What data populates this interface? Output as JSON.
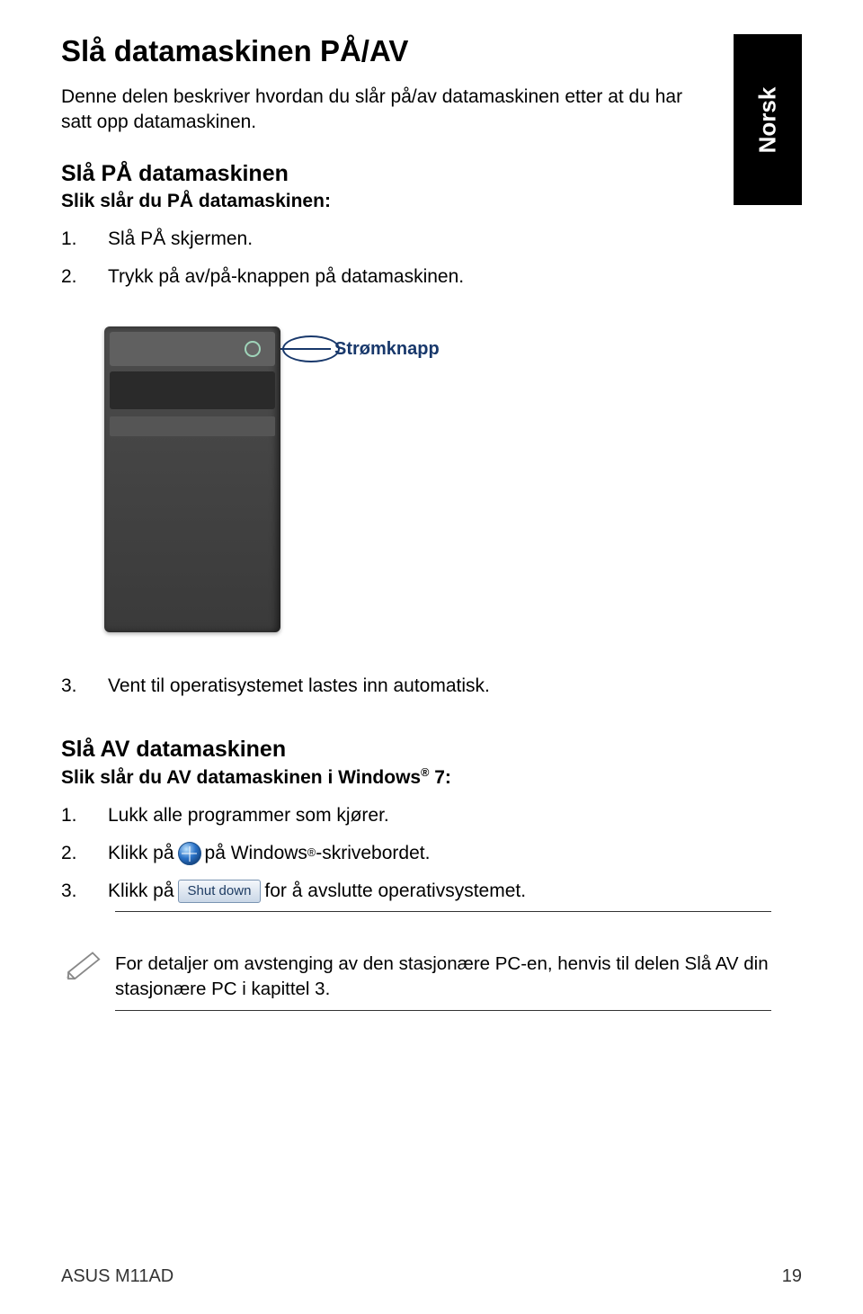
{
  "sideTab": "Norsk",
  "title": "Slå datamaskinen PÅ/AV",
  "intro": "Denne delen beskriver hvordan du slår på/av datamaskinen etter at du har satt opp datamaskinen.",
  "on": {
    "heading": "Slå PÅ datamaskinen",
    "lead": "Slik slår du PÅ datamaskinen:",
    "steps": [
      "Slå PÅ skjermen.",
      "Trykk på av/på-knappen på datamaskinen."
    ]
  },
  "figure": {
    "label": "Strømknapp"
  },
  "step3": "Vent til operatisystemet lastes inn automatisk.",
  "off": {
    "heading": "Slå AV datamaskinen",
    "lead_prefix": "Slik slår du AV datamaskinen i Windows",
    "lead_suffix": " 7:",
    "step1": "Lukk alle programmer som kjører.",
    "step2a": "Klikk på ",
    "step2b": " på Windows",
    "step2c": "-skrivebordet.",
    "step3a": "Klikk på ",
    "step3b": " for å avslutte operativsystemet.",
    "shutdown_label": "Shut down"
  },
  "note": "For detaljer om avstenging av den stasjonære PC-en, henvis til delen Slå AV din stasjonære PC i kapittel 3.",
  "footer": {
    "left": "ASUS M11AD",
    "right": "19"
  }
}
